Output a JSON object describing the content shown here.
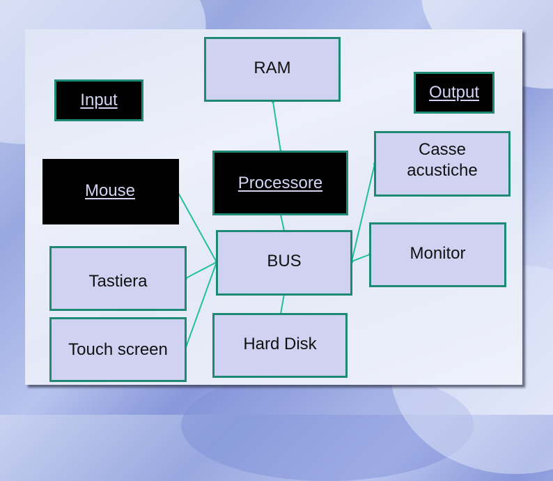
{
  "diagram": {
    "colors": {
      "box_fill": "#d0d2f2",
      "box_border": "#1e8a75",
      "dark_fill": "#000000",
      "dark_text": "#d4d4f4",
      "connector": "#20c09a"
    },
    "nodes": {
      "ram": {
        "label": "RAM",
        "style": "light"
      },
      "input": {
        "label": "Input",
        "style": "dark-link"
      },
      "output": {
        "label": "Output",
        "style": "dark-link"
      },
      "mouse": {
        "label": "Mouse",
        "style": "dark-link"
      },
      "processore": {
        "label": "Processore",
        "style": "dark-link"
      },
      "casse": {
        "label": "Casse acustiche",
        "style": "light"
      },
      "tastiera": {
        "label": "Tastiera",
        "style": "light"
      },
      "bus": {
        "label": "BUS",
        "style": "light"
      },
      "monitor": {
        "label": "Monitor",
        "style": "light"
      },
      "touch": {
        "label": "Touch screen",
        "style": "light"
      },
      "harddisk": {
        "label": "Hard Disk",
        "style": "light"
      }
    },
    "edges": [
      {
        "from": "ram",
        "to": "processore"
      },
      {
        "from": "processore",
        "to": "bus"
      },
      {
        "from": "bus",
        "to": "harddisk"
      },
      {
        "from": "mouse",
        "to": "bus"
      },
      {
        "from": "tastiera",
        "to": "bus"
      },
      {
        "from": "touch",
        "to": "bus"
      },
      {
        "from": "casse",
        "to": "bus"
      },
      {
        "from": "monitor",
        "to": "bus"
      }
    ]
  }
}
